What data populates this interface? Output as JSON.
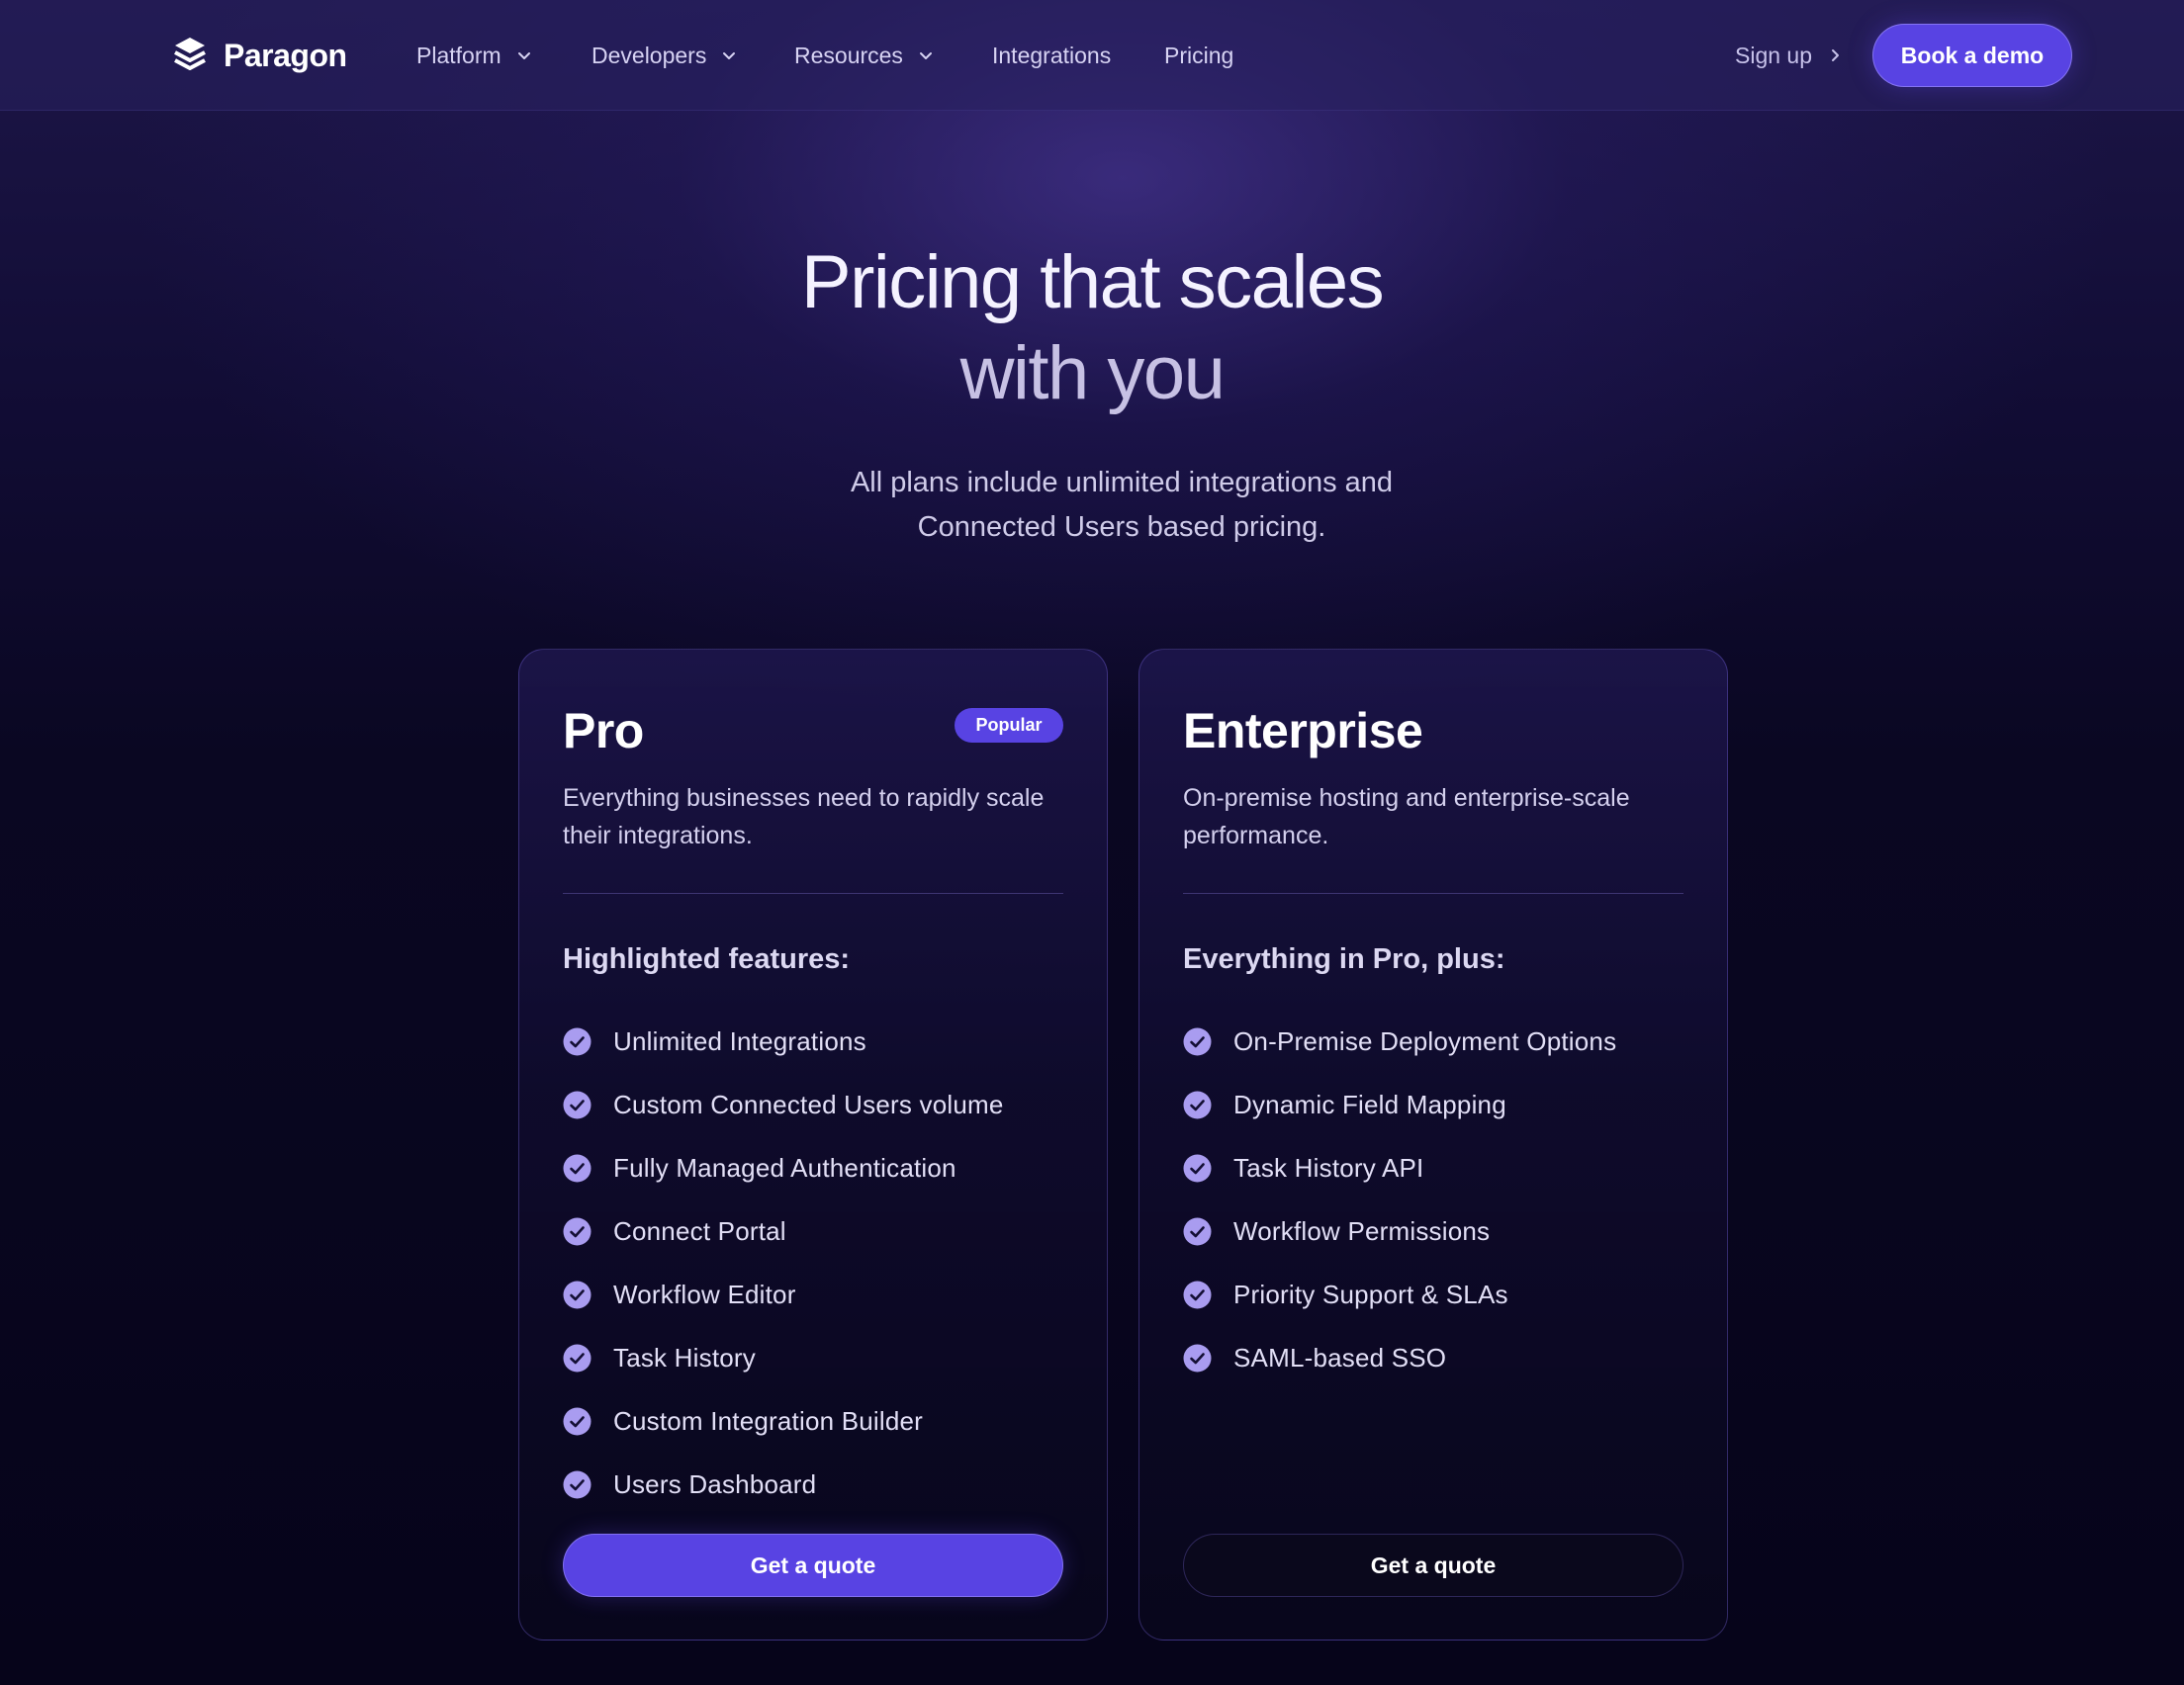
{
  "brand": {
    "name": "Paragon",
    "logo_icon": "stacked-layers-icon"
  },
  "nav": {
    "items": [
      {
        "label": "Platform",
        "has_dropdown": true
      },
      {
        "label": "Developers",
        "has_dropdown": true
      },
      {
        "label": "Resources",
        "has_dropdown": true
      },
      {
        "label": "Integrations",
        "has_dropdown": false
      },
      {
        "label": "Pricing",
        "has_dropdown": false
      }
    ],
    "signup_label": "Sign up",
    "demo_label": "Book a demo"
  },
  "hero": {
    "title_line1": "Pricing that scales",
    "title_line2": "with you",
    "subtitle_line1": "All plans include unlimited integrations and",
    "subtitle_line2": "Connected Users based pricing."
  },
  "plans": [
    {
      "name": "Pro",
      "badge": "Popular",
      "description": "Everything businesses need to rapidly scale their integrations.",
      "features_heading": "Highlighted features:",
      "features": [
        "Unlimited Integrations",
        "Custom Connected Users volume",
        "Fully Managed Authentication",
        "Connect Portal",
        "Workflow Editor",
        "Task History",
        "Custom Integration Builder",
        "Users Dashboard"
      ],
      "cta": "Get a quote"
    },
    {
      "name": "Enterprise",
      "description": "On-premise hosting and enterprise-scale performance.",
      "features_heading": "Everything in Pro, plus:",
      "features": [
        "On-Premise Deployment Options",
        "Dynamic Field Mapping",
        "Task History API",
        "Workflow Permissions",
        "Priority Support & SLAs",
        "SAML-based SSO"
      ],
      "cta": "Get a quote"
    }
  ],
  "colors": {
    "accent": "#5843e3",
    "check": "#a99cf0",
    "background": "#07051a"
  }
}
